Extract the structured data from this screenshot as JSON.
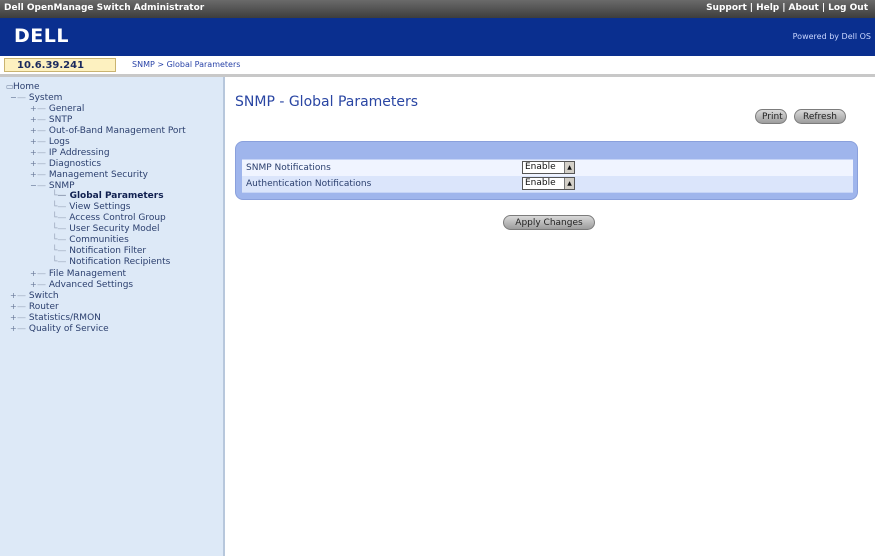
{
  "window": {
    "title": "Dell OpenManage Switch Administrator",
    "links": [
      "Support",
      "Help",
      "About",
      "Log Out"
    ]
  },
  "banner": {
    "logo": "DELL",
    "powered_by": "Powered by Dell OS"
  },
  "device": {
    "ip": "10.6.39.241"
  },
  "breadcrumb": "SNMP > Global Parameters",
  "tree": {
    "root": "Home",
    "system": "System",
    "items": [
      {
        "label": "General"
      },
      {
        "label": "SNTP"
      },
      {
        "label": "Out-of-Band Management Port"
      },
      {
        "label": "Logs"
      },
      {
        "label": "IP Addressing"
      },
      {
        "label": "Diagnostics"
      },
      {
        "label": "Management Security"
      },
      {
        "label": "SNMP"
      }
    ],
    "snmp_children": [
      {
        "label": "Global Parameters"
      },
      {
        "label": "View Settings"
      },
      {
        "label": "Access Control Group"
      },
      {
        "label": "User Security Model"
      },
      {
        "label": "Communities"
      },
      {
        "label": "Notification Filter"
      },
      {
        "label": "Notification Recipients"
      }
    ],
    "after_snmp": [
      {
        "label": "File Management"
      },
      {
        "label": "Advanced Settings"
      }
    ],
    "top_level": [
      {
        "label": "Switch"
      },
      {
        "label": "Router"
      },
      {
        "label": "Statistics/RMON"
      },
      {
        "label": "Quality of Service"
      }
    ]
  },
  "page": {
    "title": "SNMP - Global Parameters",
    "print_label": "Print",
    "refresh_label": "Refresh",
    "apply_label": "Apply Changes",
    "fields": [
      {
        "label": "SNMP Notifications",
        "value": "Enable"
      },
      {
        "label": "Authentication Notifications",
        "value": "Enable"
      }
    ]
  },
  "colors": {
    "banner": "#0a2f8f",
    "sidebar": "#dde9f7",
    "panel": "#9fb5ec",
    "title": "#2a46a3"
  }
}
